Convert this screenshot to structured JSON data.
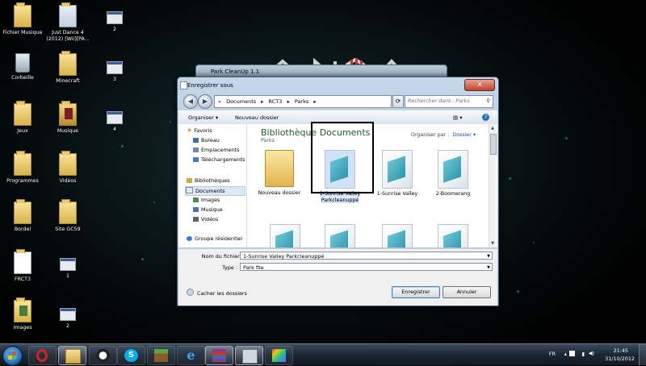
{
  "desktop": {
    "icons": [
      {
        "label": "Fichier Musique",
        "kind": "folder"
      },
      {
        "label": "Just Dance 4 (2012) [Wii][PA...",
        "kind": "file"
      },
      {
        "label": "2",
        "kind": "window"
      },
      {
        "label": "Corbeille",
        "kind": "bin"
      },
      {
        "label": "Minecraft",
        "kind": "folder"
      },
      {
        "label": "3",
        "kind": "window"
      },
      {
        "label": "Jeux",
        "kind": "folder"
      },
      {
        "label": "Musique",
        "kind": "folder"
      },
      {
        "label": "4",
        "kind": "window"
      },
      {
        "label": "Programmes",
        "kind": "folder"
      },
      {
        "label": "Vidéos",
        "kind": "folder"
      },
      {
        "label": "Bordel",
        "kind": "folder"
      },
      {
        "label": "Site GC59",
        "kind": "folder"
      },
      {
        "label": "FRCT3",
        "kind": "folder"
      },
      {
        "label": "1",
        "kind": "window"
      },
      {
        "label": "Images",
        "kind": "folder"
      },
      {
        "label": "2",
        "kind": "window"
      }
    ]
  },
  "background_window": {
    "title": "Park CleanUp 1.1"
  },
  "dialog": {
    "title": "Enregistrer sous",
    "close": "x",
    "address": {
      "prefix": "«",
      "parts": [
        "Documents",
        "RCT3",
        "Parks"
      ],
      "sep": "▸"
    },
    "search_placeholder": "Rechercher dans : Parks",
    "toolbar": {
      "organize": "Organiser ▾",
      "new_folder": "Nouveau dossier"
    },
    "sidebar": {
      "favorites": "Favoris",
      "favorites_items": [
        "Bureau",
        "Emplacements",
        "Téléchargements"
      ],
      "libraries": "Bibliothèques",
      "library_items": [
        "Documents",
        "Images",
        "Musique",
        "Vidéos"
      ],
      "homegroup": "Groupe résidentiel"
    },
    "library_title": "Bibliothèque Documents",
    "library_subtitle": "Parks",
    "arrange_label": "Organiser par :",
    "arrange_value": "Dossier ▾",
    "files": [
      {
        "label": "Nouveau dossier",
        "type": "folder"
      },
      {
        "label": "1-Sunrise Valley Parkcleanuppé",
        "type": "doc",
        "selected": true
      },
      {
        "label": "1-Sunrise Valley",
        "type": "doc"
      },
      {
        "label": "2-Boomerang",
        "type": "doc"
      },
      {
        "label": "",
        "type": "doc"
      },
      {
        "label": "",
        "type": "doc"
      },
      {
        "label": "",
        "type": "doc"
      },
      {
        "label": "",
        "type": "doc"
      }
    ],
    "filename_label": "Nom du fichier :",
    "filename_value": "1-Sunrise Valley Parkcleanuppé",
    "type_label": "Type :",
    "type_value": "Park file",
    "hide_folders": "Cacher les dossiers",
    "save": "Enregistrer",
    "cancel": "Annuler"
  },
  "taskbar": {
    "lang": "FR",
    "time": "21:45",
    "date": "31/10/2012"
  }
}
